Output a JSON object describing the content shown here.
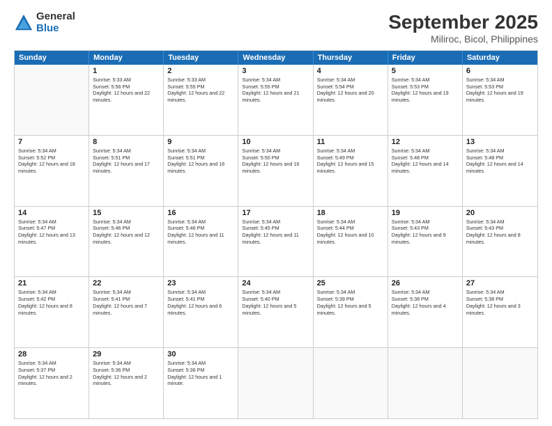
{
  "logo": {
    "general": "General",
    "blue": "Blue"
  },
  "title": "September 2025",
  "location": "Miliroc, Bicol, Philippines",
  "days": [
    "Sunday",
    "Monday",
    "Tuesday",
    "Wednesday",
    "Thursday",
    "Friday",
    "Saturday"
  ],
  "weeks": [
    [
      {
        "day": "",
        "sunrise": "",
        "sunset": "",
        "daylight": ""
      },
      {
        "day": "1",
        "sunrise": "Sunrise: 5:33 AM",
        "sunset": "Sunset: 5:56 PM",
        "daylight": "Daylight: 12 hours and 22 minutes."
      },
      {
        "day": "2",
        "sunrise": "Sunrise: 5:33 AM",
        "sunset": "Sunset: 5:55 PM",
        "daylight": "Daylight: 12 hours and 22 minutes."
      },
      {
        "day": "3",
        "sunrise": "Sunrise: 5:34 AM",
        "sunset": "Sunset: 5:55 PM",
        "daylight": "Daylight: 12 hours and 21 minutes."
      },
      {
        "day": "4",
        "sunrise": "Sunrise: 5:34 AM",
        "sunset": "Sunset: 5:54 PM",
        "daylight": "Daylight: 12 hours and 20 minutes."
      },
      {
        "day": "5",
        "sunrise": "Sunrise: 5:34 AM",
        "sunset": "Sunset: 5:53 PM",
        "daylight": "Daylight: 12 hours and 19 minutes."
      },
      {
        "day": "6",
        "sunrise": "Sunrise: 5:34 AM",
        "sunset": "Sunset: 5:53 PM",
        "daylight": "Daylight: 12 hours and 19 minutes."
      }
    ],
    [
      {
        "day": "7",
        "sunrise": "Sunrise: 5:34 AM",
        "sunset": "Sunset: 5:52 PM",
        "daylight": "Daylight: 12 hours and 18 minutes."
      },
      {
        "day": "8",
        "sunrise": "Sunrise: 5:34 AM",
        "sunset": "Sunset: 5:51 PM",
        "daylight": "Daylight: 12 hours and 17 minutes."
      },
      {
        "day": "9",
        "sunrise": "Sunrise: 5:34 AM",
        "sunset": "Sunset: 5:51 PM",
        "daylight": "Daylight: 12 hours and 16 minutes."
      },
      {
        "day": "10",
        "sunrise": "Sunrise: 5:34 AM",
        "sunset": "Sunset: 5:50 PM",
        "daylight": "Daylight: 12 hours and 16 minutes."
      },
      {
        "day": "11",
        "sunrise": "Sunrise: 5:34 AM",
        "sunset": "Sunset: 5:49 PM",
        "daylight": "Daylight: 12 hours and 15 minutes."
      },
      {
        "day": "12",
        "sunrise": "Sunrise: 5:34 AM",
        "sunset": "Sunset: 5:48 PM",
        "daylight": "Daylight: 12 hours and 14 minutes."
      },
      {
        "day": "13",
        "sunrise": "Sunrise: 5:34 AM",
        "sunset": "Sunset: 5:48 PM",
        "daylight": "Daylight: 12 hours and 14 minutes."
      }
    ],
    [
      {
        "day": "14",
        "sunrise": "Sunrise: 5:34 AM",
        "sunset": "Sunset: 5:47 PM",
        "daylight": "Daylight: 12 hours and 13 minutes."
      },
      {
        "day": "15",
        "sunrise": "Sunrise: 5:34 AM",
        "sunset": "Sunset: 5:46 PM",
        "daylight": "Daylight: 12 hours and 12 minutes."
      },
      {
        "day": "16",
        "sunrise": "Sunrise: 5:34 AM",
        "sunset": "Sunset: 5:46 PM",
        "daylight": "Daylight: 12 hours and 11 minutes."
      },
      {
        "day": "17",
        "sunrise": "Sunrise: 5:34 AM",
        "sunset": "Sunset: 5:45 PM",
        "daylight": "Daylight: 12 hours and 11 minutes."
      },
      {
        "day": "18",
        "sunrise": "Sunrise: 5:34 AM",
        "sunset": "Sunset: 5:44 PM",
        "daylight": "Daylight: 12 hours and 10 minutes."
      },
      {
        "day": "19",
        "sunrise": "Sunrise: 5:34 AM",
        "sunset": "Sunset: 5:43 PM",
        "daylight": "Daylight: 12 hours and 9 minutes."
      },
      {
        "day": "20",
        "sunrise": "Sunrise: 5:34 AM",
        "sunset": "Sunset: 5:43 PM",
        "daylight": "Daylight: 12 hours and 8 minutes."
      }
    ],
    [
      {
        "day": "21",
        "sunrise": "Sunrise: 5:34 AM",
        "sunset": "Sunset: 5:42 PM",
        "daylight": "Daylight: 12 hours and 8 minutes."
      },
      {
        "day": "22",
        "sunrise": "Sunrise: 5:34 AM",
        "sunset": "Sunset: 5:41 PM",
        "daylight": "Daylight: 12 hours and 7 minutes."
      },
      {
        "day": "23",
        "sunrise": "Sunrise: 5:34 AM",
        "sunset": "Sunset: 5:41 PM",
        "daylight": "Daylight: 12 hours and 6 minutes."
      },
      {
        "day": "24",
        "sunrise": "Sunrise: 5:34 AM",
        "sunset": "Sunset: 5:40 PM",
        "daylight": "Daylight: 12 hours and 5 minutes."
      },
      {
        "day": "25",
        "sunrise": "Sunrise: 5:34 AM",
        "sunset": "Sunset: 5:39 PM",
        "daylight": "Daylight: 12 hours and 5 minutes."
      },
      {
        "day": "26",
        "sunrise": "Sunrise: 5:34 AM",
        "sunset": "Sunset: 5:38 PM",
        "daylight": "Daylight: 12 hours and 4 minutes."
      },
      {
        "day": "27",
        "sunrise": "Sunrise: 5:34 AM",
        "sunset": "Sunset: 5:38 PM",
        "daylight": "Daylight: 12 hours and 3 minutes."
      }
    ],
    [
      {
        "day": "28",
        "sunrise": "Sunrise: 5:34 AM",
        "sunset": "Sunset: 5:37 PM",
        "daylight": "Daylight: 12 hours and 2 minutes."
      },
      {
        "day": "29",
        "sunrise": "Sunrise: 5:34 AM",
        "sunset": "Sunset: 5:36 PM",
        "daylight": "Daylight: 12 hours and 2 minutes."
      },
      {
        "day": "30",
        "sunrise": "Sunrise: 5:34 AM",
        "sunset": "Sunset: 5:36 PM",
        "daylight": "Daylight: 12 hours and 1 minute."
      },
      {
        "day": "",
        "sunrise": "",
        "sunset": "",
        "daylight": ""
      },
      {
        "day": "",
        "sunrise": "",
        "sunset": "",
        "daylight": ""
      },
      {
        "day": "",
        "sunrise": "",
        "sunset": "",
        "daylight": ""
      },
      {
        "day": "",
        "sunrise": "",
        "sunset": "",
        "daylight": ""
      }
    ]
  ]
}
